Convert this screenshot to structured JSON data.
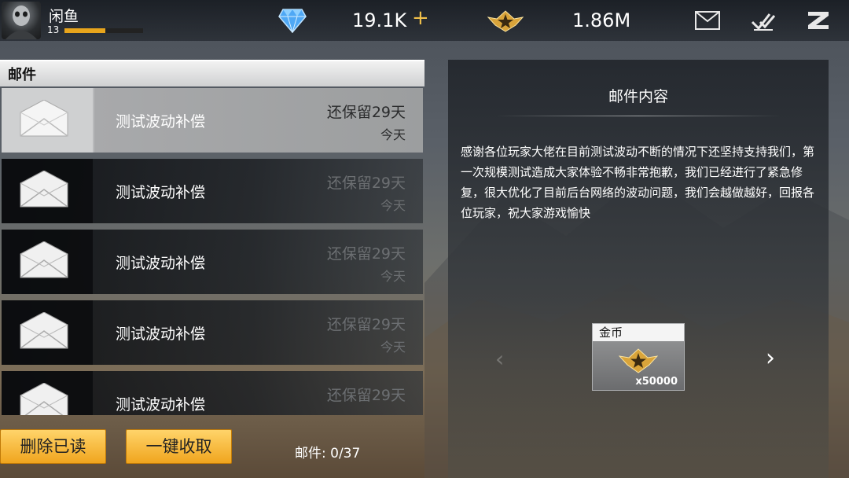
{
  "player": {
    "name": "闲鱼",
    "level": "13",
    "xp_fraction": 0.52
  },
  "currency": {
    "gems": "19.1K",
    "gems_plus": "+",
    "gold": "1.86M"
  },
  "icons": {
    "diamond": "diamond-icon",
    "gold": "gold-star-icon",
    "mail": "mail-icon",
    "check": "check-all-icon",
    "exit": "exit-icon"
  },
  "mail_panel": {
    "title": "邮件",
    "items": [
      {
        "title": "测试波动补偿",
        "keep": "还保留29天",
        "date": "今天",
        "selected": true
      },
      {
        "title": "测试波动补偿",
        "keep": "还保留29天",
        "date": "今天",
        "selected": false
      },
      {
        "title": "测试波动补偿",
        "keep": "还保留29天",
        "date": "今天",
        "selected": false
      },
      {
        "title": "测试波动补偿",
        "keep": "还保留29天",
        "date": "今天",
        "selected": false
      },
      {
        "title": "测试波动补偿",
        "keep": "还保留29天",
        "date": "",
        "selected": false
      }
    ],
    "delete_read_label": "删除已读",
    "collect_all_label": "一键收取",
    "mail_count": "邮件: 0/37"
  },
  "content_panel": {
    "title": "邮件内容",
    "body": "感谢各位玩家大佬在目前测试波动不断的情况下还坚持支持我们，第一次规模测试造成大家体验不畅非常抱歉，我们已经进行了紧急修复，很大优化了目前后台网络的波动问题，我们会越做越好，回报各位玩家，祝大家游戏愉快",
    "reward": {
      "name": "金币",
      "quantity": "x50000"
    },
    "nav_prev": "‹",
    "nav_next": "›"
  },
  "colors": {
    "accent_gold": "#f0a51e",
    "xp": "#e8a51c"
  }
}
